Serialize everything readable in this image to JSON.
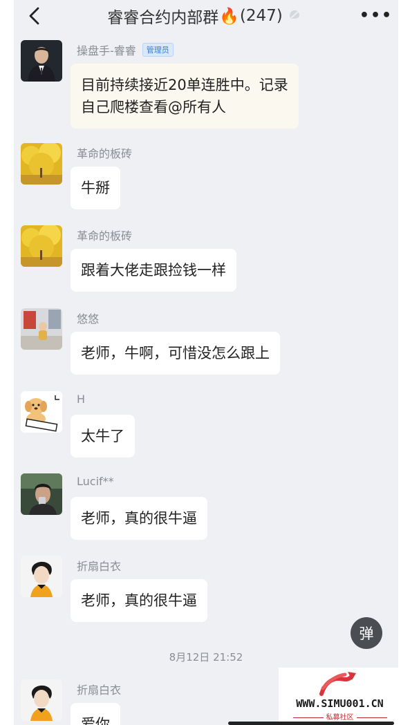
{
  "header": {
    "title": "睿睿合约内部群",
    "fire_icon": "🔥",
    "count": "(247)",
    "back_icon": "chevron-left-icon",
    "more_label": "•••"
  },
  "messages": [
    {
      "sender": "操盘手-睿睿",
      "badge": "管理员",
      "lines": [
        "目前持续接近20单连胜中。记录",
        "自己爬楼查看@所有人"
      ]
    },
    {
      "sender": "革命的板砖",
      "lines": [
        "牛掰"
      ]
    },
    {
      "sender": "革命的板砖",
      "lines": [
        "跟着大佬走跟捡钱一样"
      ]
    },
    {
      "sender": "悠悠",
      "lines": [
        "老师，牛啊，可惜没怎么跟上"
      ]
    },
    {
      "sender": "H",
      "lines": [
        "太牛了"
      ]
    },
    {
      "sender": "Lucif**",
      "lines": [
        "老师，真的很牛逼"
      ]
    },
    {
      "sender": "折扇白衣",
      "lines": [
        "老师，真的很牛逼"
      ]
    },
    {
      "sender": "折扇白衣",
      "lines": [
        "爱你"
      ]
    }
  ],
  "timestamp": "8月12日 21:52",
  "danmu_label": "弹",
  "watermark": {
    "url": "WWW.SIMU001.CN",
    "sub": "私募社区"
  },
  "colors": {
    "chat_bg": "#eef0f4",
    "bubble": "#ffffff",
    "admin_badge": "#3a7bd5",
    "watermark_red": "#c0262d"
  }
}
